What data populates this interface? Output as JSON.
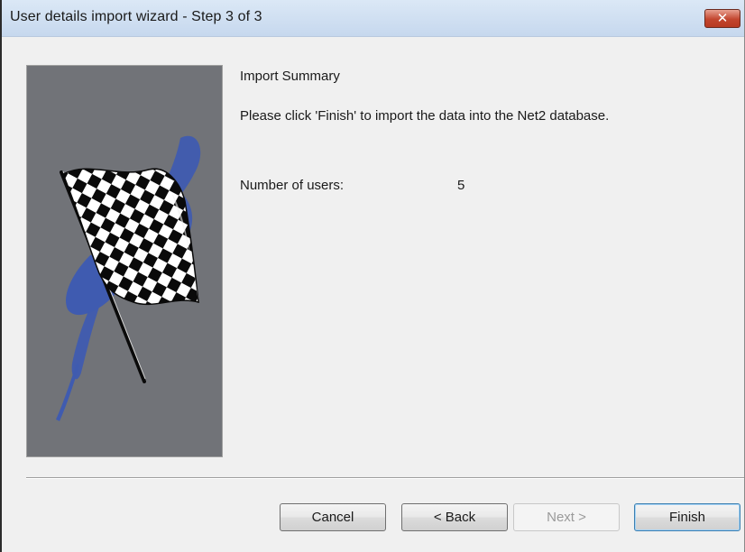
{
  "window": {
    "title": "User details import wizard - Step 3 of 3",
    "close_glyph": "✕"
  },
  "summary": {
    "heading": "Import Summary",
    "instruction": "Please click 'Finish' to import the data into the Net2 database.",
    "users_label": "Number of users:",
    "users_value": "5"
  },
  "buttons": {
    "cancel": "Cancel",
    "back": "< Back",
    "next": "Next >",
    "finish": "Finish"
  },
  "image": {
    "icon": "checkered-flag-icon",
    "background_color": "#717378",
    "splash_color": "#3f5bb0"
  }
}
